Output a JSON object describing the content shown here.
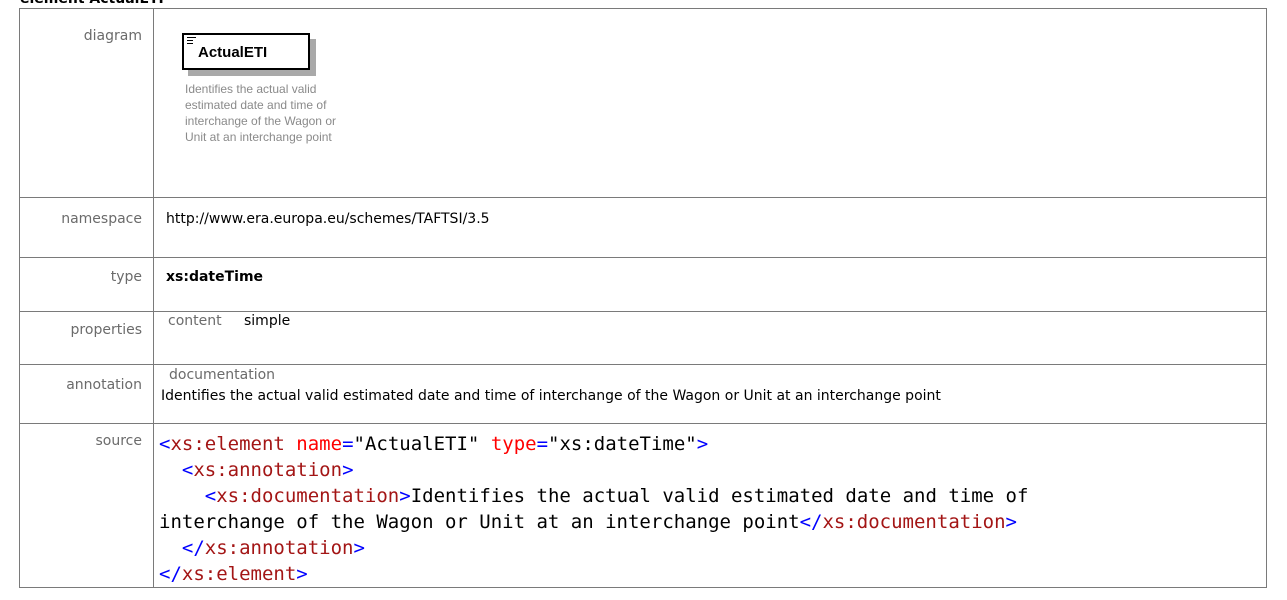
{
  "heading": "element ActualETI",
  "rows": {
    "diagram": {
      "label": "diagram",
      "element_name": "ActualETI",
      "element_doc": "Identifies the actual valid estimated date and time of interchange of the Wagon or Unit at an interchange point"
    },
    "namespace": {
      "label": "namespace",
      "value": "http://www.era.europa.eu/schemes/TAFTSI/3.5"
    },
    "type": {
      "label": "type",
      "value": "xs:dateTime"
    },
    "properties": {
      "label": "properties",
      "key": "content",
      "value": "simple"
    },
    "annotation": {
      "label": "annotation",
      "key": "documentation",
      "value": "Identifies the actual valid estimated date and time of interchange of the Wagon or Unit at an interchange point"
    },
    "source": {
      "label": "source",
      "lines": {
        "l1_open": "<",
        "l1_tag": "xs:element",
        "l1_attr1": "name",
        "l1_eq1": "=",
        "l1_val1": "\"ActualETI\"",
        "l1_attr2": "type",
        "l1_eq2": "=",
        "l1_val2": "\"xs:dateTime\"",
        "l1_close": ">",
        "l2_open": "<",
        "l2_tag": "xs:annotation",
        "l2_close": ">",
        "l3_open": "<",
        "l3_tag": "xs:documentation",
        "l3_close": ">",
        "l3_text": "Identifies the actual valid estimated date and time of",
        "l4_text": "interchange of the Wagon or Unit at an interchange point",
        "l4_open": "</",
        "l4_tag": "xs:documentation",
        "l4_close": ">",
        "l5_open": "</",
        "l5_tag": "xs:annotation",
        "l5_close": ">",
        "l6_open": "</",
        "l6_tag": "xs:element",
        "l6_close": ">"
      }
    }
  }
}
